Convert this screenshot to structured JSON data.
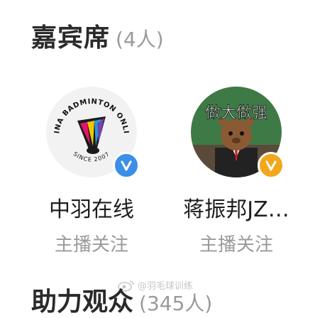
{
  "sections": [
    {
      "title": "嘉宾席",
      "count": "(4人)"
    },
    {
      "title": "助力观众",
      "count": "(345人)"
    }
  ],
  "guests": [
    {
      "name": "中羽在线",
      "action": "主播关注",
      "avatar_text": "CHINA BADMINTON ONLINE",
      "avatar_subtext": "SINCE 2007",
      "badge_color": "#3b8fe6",
      "badge_icon": "v-check-icon"
    },
    {
      "name": "蒋振邦JZ…",
      "action": "主播关注",
      "avatar_text": "做大做强",
      "badge_color": "#f2a71b",
      "badge_icon": "v-check-icon"
    }
  ],
  "watermark": "@羽毛球训练"
}
